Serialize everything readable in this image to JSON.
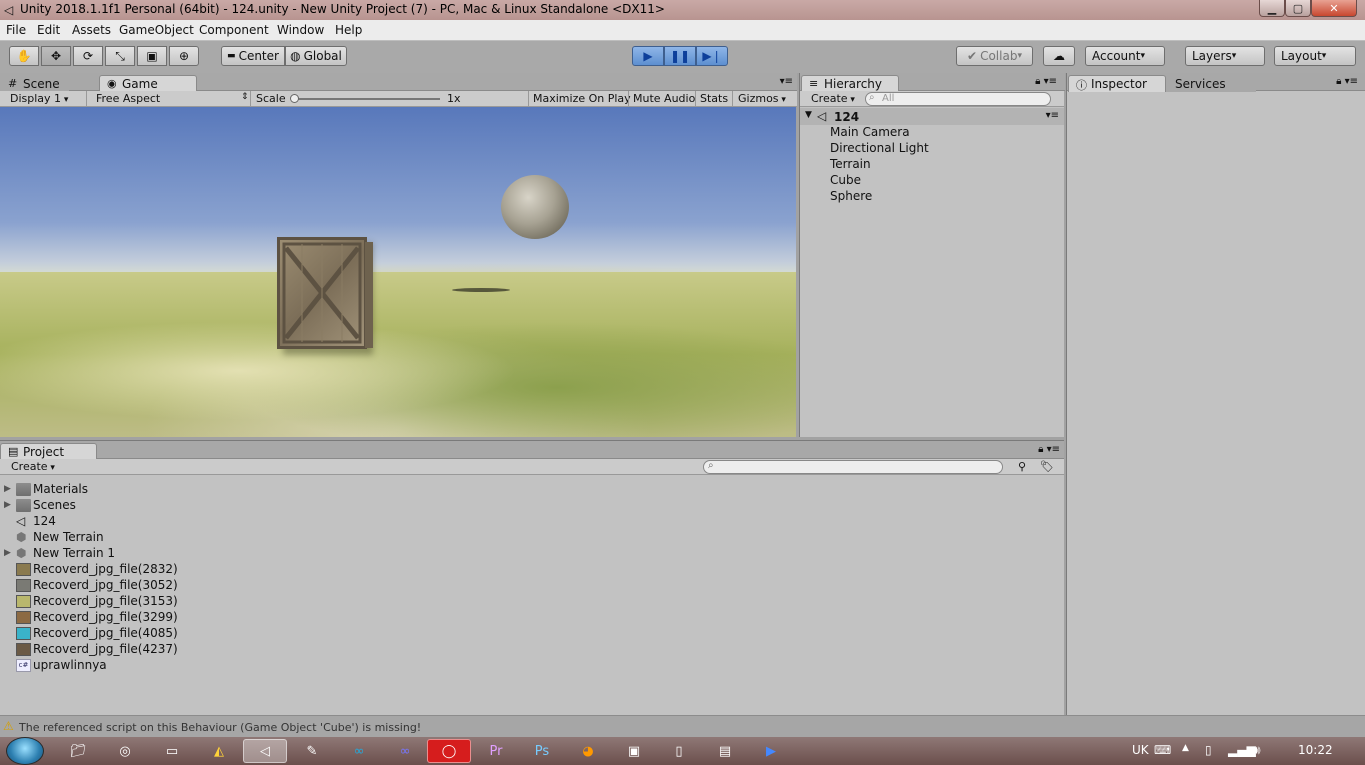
{
  "window": {
    "title": "Unity 2018.1.1f1 Personal (64bit) - 124.unity - New Unity Project (7) - PC, Mac & Linux Standalone <DX11>"
  },
  "menu": [
    "File",
    "Edit",
    "Assets",
    "GameObject",
    "Component",
    "Window",
    "Help"
  ],
  "toolbar": {
    "tools": [
      "hand-icon",
      "move-icon",
      "rotate-icon",
      "scale-icon",
      "rect-icon",
      "transform-icon"
    ],
    "pivot": "Center",
    "space": "Global",
    "collab": "Collab",
    "account": "Account",
    "layers": "Layers",
    "layout": "Layout"
  },
  "scene_tabs": {
    "scene": "Scene",
    "game": "Game"
  },
  "game_bar": {
    "display": "Display 1",
    "aspect": "Free Aspect",
    "scale_label": "Scale",
    "scale_value": "1x",
    "maximize": "Maximize On Play",
    "mute": "Mute Audio",
    "stats": "Stats",
    "gizmos": "Gizmos"
  },
  "hierarchy": {
    "tab": "Hierarchy",
    "create": "Create",
    "search_placeholder": "All",
    "scene": "124",
    "items": [
      "Main Camera",
      "Directional Light",
      "Terrain",
      "Cube",
      "Sphere"
    ]
  },
  "inspector": {
    "tab": "Inspector",
    "services": "Services"
  },
  "project": {
    "tab": "Project",
    "create": "Create",
    "items": [
      {
        "name": "Materials",
        "kind": "folder"
      },
      {
        "name": "Scenes",
        "kind": "folder"
      },
      {
        "name": "124",
        "kind": "scene"
      },
      {
        "name": "New Terrain",
        "kind": "terrain"
      },
      {
        "name": "New Terrain 1",
        "kind": "terrain"
      },
      {
        "name": "Recoverd_jpg_file(2832)",
        "kind": "texture",
        "color": "#8a7a4f"
      },
      {
        "name": "Recoverd_jpg_file(3052)",
        "kind": "texture",
        "color": "#7a7a74"
      },
      {
        "name": "Recoverd_jpg_file(3153)",
        "kind": "texture",
        "color": "#b9b76d"
      },
      {
        "name": "Recoverd_jpg_file(3299)",
        "kind": "texture",
        "color": "#8c6a43"
      },
      {
        "name": "Recoverd_jpg_file(4085)",
        "kind": "texture",
        "color": "#3ab3c9"
      },
      {
        "name": "Recoverd_jpg_file(4237)",
        "kind": "texture",
        "color": "#6b5a45"
      },
      {
        "name": "uprawlinnya",
        "kind": "script"
      }
    ]
  },
  "status": {
    "message": "The referenced script on this Behaviour (Game Object 'Cube') is missing!"
  },
  "taskbar": {
    "lang": "UK",
    "time": "10:22"
  }
}
